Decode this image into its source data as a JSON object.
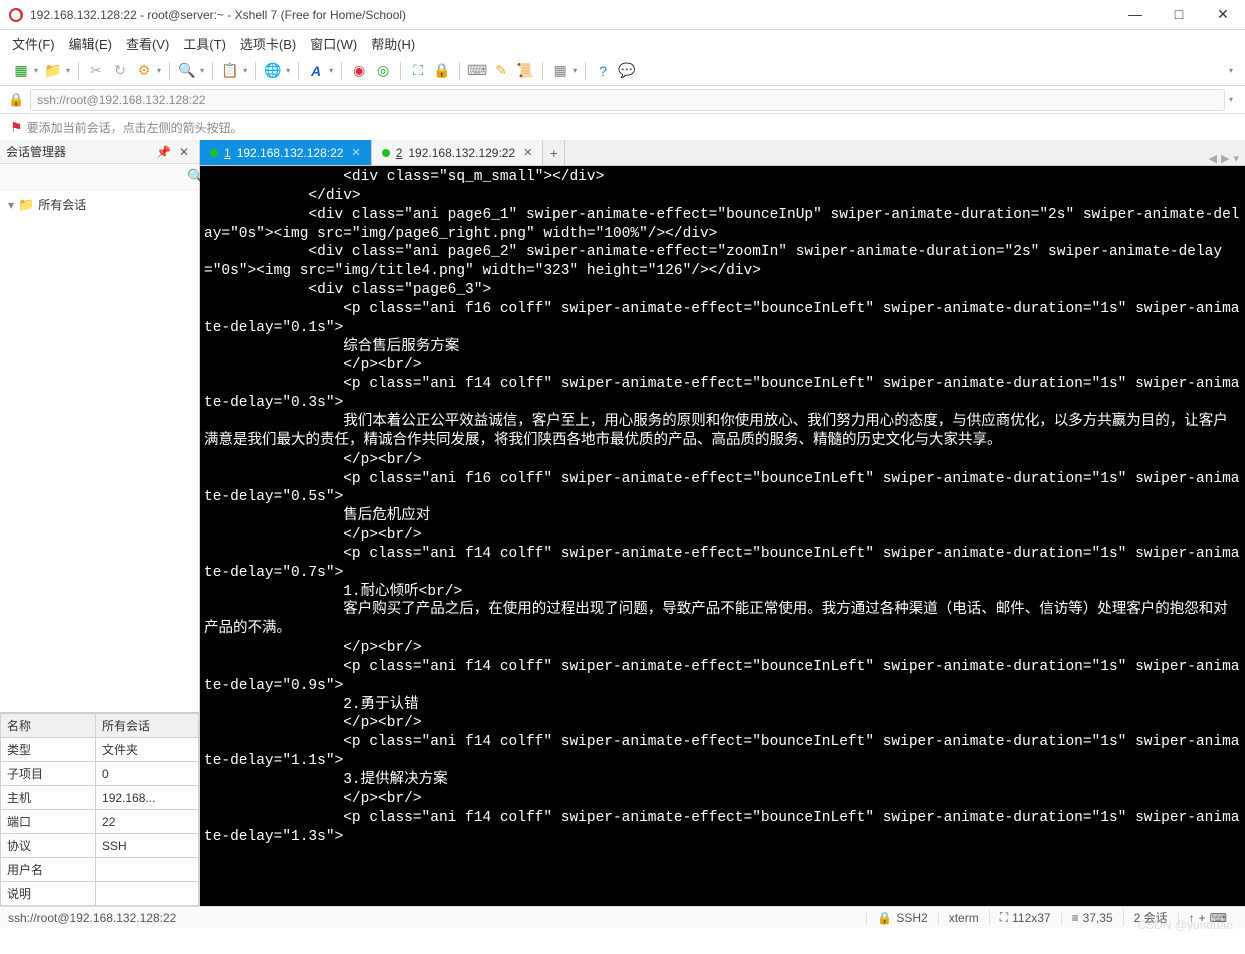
{
  "title": "192.168.132.128:22 - root@server:~ - Xshell 7 (Free for Home/School)",
  "menu": [
    "文件(F)",
    "编辑(E)",
    "查看(V)",
    "工具(T)",
    "选项卡(B)",
    "窗口(W)",
    "帮助(H)"
  ],
  "address": "ssh://root@192.168.132.128:22",
  "hint": "要添加当前会话，点击左侧的箭头按钮。",
  "sidebar": {
    "title": "会话管理器",
    "tree_root": "所有会话"
  },
  "props": {
    "header_name": "名称",
    "header_value": "所有会话",
    "rows": [
      {
        "k": "类型",
        "v": "文件夹"
      },
      {
        "k": "子项目",
        "v": "0"
      },
      {
        "k": "主机",
        "v": "192.168..."
      },
      {
        "k": "端口",
        "v": "22"
      },
      {
        "k": "协议",
        "v": "SSH"
      },
      {
        "k": "用户名",
        "v": ""
      },
      {
        "k": "说明",
        "v": ""
      }
    ]
  },
  "tabs": [
    {
      "num": "1",
      "label": "192.168.132.128:22",
      "active": true
    },
    {
      "num": "2",
      "label": "192.168.132.129:22",
      "active": false
    }
  ],
  "terminal_lines": [
    "                <div class=\"sq_m_small\"></div>",
    "            </div>",
    "            <div class=\"ani page6_1\" swiper-animate-effect=\"bounceInUp\" swiper-animate-duration=\"2s\" swiper-animate-delay=\"0s\"><img src=\"img/page6_right.png\" width=\"100%\"/></div>",
    "            <div class=\"ani page6_2\" swiper-animate-effect=\"zoomIn\" swiper-animate-duration=\"2s\" swiper-animate-delay=\"0s\"><img src=\"img/title4.png\" width=\"323\" height=\"126\"/></div>",
    "            <div class=\"page6_3\">",
    "                <p class=\"ani f16 colff\" swiper-animate-effect=\"bounceInLeft\" swiper-animate-duration=\"1s\" swiper-animate-delay=\"0.1s\">",
    "                综合售后服务方案",
    "                </p><br/>",
    "                <p class=\"ani f14 colff\" swiper-animate-effect=\"bounceInLeft\" swiper-animate-duration=\"1s\" swiper-animate-delay=\"0.3s\">",
    "                我们本着公正公平效益诚信，客户至上，用心服务的原则和你使用放心、我们努力用心的态度，与供应商优化，以多方共赢为目的，让客户满意是我们最大的责任，精诚合作共同发展，将我们陕西各地市最优质的产品、高品质的服务、精髓的历史文化与大家共享。",
    "                </p><br/>",
    "                <p class=\"ani f16 colff\" swiper-animate-effect=\"bounceInLeft\" swiper-animate-duration=\"1s\" swiper-animate-delay=\"0.5s\">",
    "                售后危机应对",
    "                </p><br/>",
    "                <p class=\"ani f14 colff\" swiper-animate-effect=\"bounceInLeft\" swiper-animate-duration=\"1s\" swiper-animate-delay=\"0.7s\">",
    "                1.耐心倾听<br/>",
    "                客户购买了产品之后，在使用的过程出现了问题，导致产品不能正常使用。我方通过各种渠道（电话、邮件、信访等）处理客户的抱怨和对产品的不满。",
    "                </p><br/>",
    "                <p class=\"ani f14 colff\" swiper-animate-effect=\"bounceInLeft\" swiper-animate-duration=\"1s\" swiper-animate-delay=\"0.9s\">",
    "                2.勇于认错",
    "                </p><br/>",
    "                <p class=\"ani f14 colff\" swiper-animate-effect=\"bounceInLeft\" swiper-animate-duration=\"1s\" swiper-animate-delay=\"1.1s\">",
    "                3.提供解决方案",
    "                </p><br/>",
    "                <p class=\"ani f14 colff\" swiper-animate-effect=\"bounceInLeft\" swiper-animate-duration=\"1s\" swiper-animate-delay=\"1.3s\">"
  ],
  "status": {
    "left": "ssh://root@192.168.132.128:22",
    "proto": "SSH2",
    "term": "xterm",
    "size": "112x37",
    "pos": "37,35",
    "sessions": "2 会话",
    "nav_up": "↑",
    "nav_add": "+",
    "nav_kb": "⌨"
  },
  "watermark": "CSDN @yunduan"
}
